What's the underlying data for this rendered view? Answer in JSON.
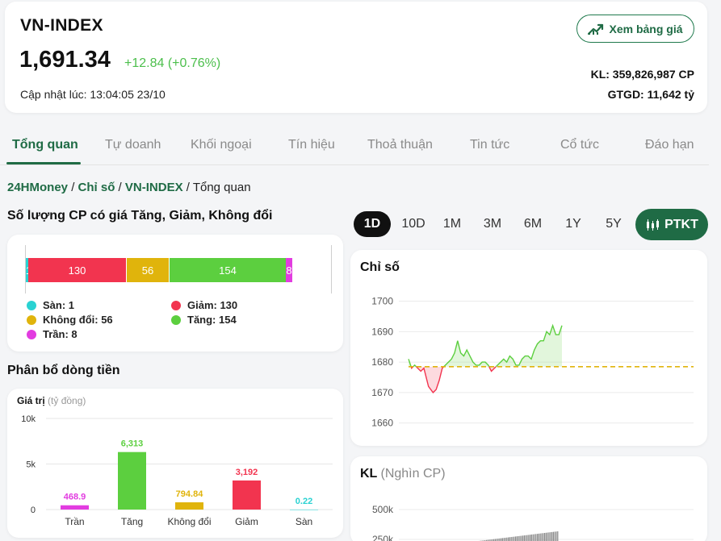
{
  "header": {
    "title": "VN-INDEX",
    "value": "1,691.34",
    "change": "+12.84 (+0.76%)",
    "update_time": "Cập nhật lúc: 13:04:05 23/10",
    "board_button": "Xem bảng giá",
    "volume": "KL: 359,826,987 CP",
    "value_traded": "GTGD: 11,642 tỷ"
  },
  "tabs": [
    "Tổng quan",
    "Tự doanh",
    "Khối ngoại",
    "Tín hiệu",
    "Thoả thuận",
    "Tin tức",
    "Cổ tức",
    "Đáo hạn"
  ],
  "breadcrumb": {
    "home": "24HMoney",
    "sep": " / ",
    "section": "Chỉ số",
    "index": "VN-INDEX",
    "current": "Tổng quan"
  },
  "breadth": {
    "title": "Số lượng CP có giá Tăng, Giảm, Không đổi",
    "bar_labels": {
      "san": "1",
      "giam": "130",
      "khong_doi": "56",
      "tang": "154",
      "tran": "8"
    },
    "legend": {
      "san": "Sàn: 1",
      "giam": "Giảm: 130",
      "khong_doi": "Không đổi: 56",
      "tang": "Tăng: 154",
      "tran": "Trần: 8"
    }
  },
  "flow": {
    "title": "Phân bổ dòng tiền",
    "axis_label": "Giá trị",
    "axis_unit": "(tỷ đồng)"
  },
  "range_buttons": [
    "1D",
    "10D",
    "1M",
    "3M",
    "6M",
    "1Y",
    "5Y"
  ],
  "ptkt_label": "PTKT",
  "index_chart": {
    "title": "Chỉ số"
  },
  "kl_chart": {
    "title": "KL",
    "unit": "(Nghìn CP)",
    "ticks": [
      "500k",
      "250k"
    ]
  },
  "colors": {
    "brand": "#1f6b45",
    "up": "#5ccf3f",
    "down": "#f2344f",
    "flat": "#e0b40c",
    "ceiling": "#e23ce0",
    "floor": "#2ad2d2"
  },
  "chart_data": [
    {
      "type": "bar",
      "stacked": true,
      "orientation": "horizontal",
      "categories": [
        "Sàn",
        "Giảm",
        "Không đổi",
        "Tăng",
        "Trần"
      ],
      "values": [
        1,
        130,
        56,
        154,
        8
      ],
      "colors": [
        "#2ad2d2",
        "#f2344f",
        "#e0b40c",
        "#5ccf3f",
        "#e23ce0"
      ]
    },
    {
      "type": "bar",
      "categories": [
        "Trần",
        "Tăng",
        "Không đổi",
        "Giảm",
        "Sàn"
      ],
      "values": [
        468.9,
        6313,
        794.84,
        3192,
        0.22
      ],
      "value_labels": [
        "468.9",
        "6,313",
        "794.84",
        "3,192",
        "0.22"
      ],
      "colors": [
        "#e23ce0",
        "#5ccf3f",
        "#e0b40c",
        "#f2344f",
        "#2ad2d2"
      ],
      "ylabel": "Giá trị (tỷ đồng)",
      "ylim": [
        0,
        10000
      ],
      "yticks": [
        0,
        5000,
        10000
      ],
      "ytick_labels": [
        "0",
        "5k",
        "10k"
      ]
    },
    {
      "type": "line",
      "title": "Chỉ số",
      "reference": 1678.5,
      "ylim": [
        1657,
        1702
      ],
      "yticks": [
        1660,
        1670,
        1680,
        1690,
        1700
      ],
      "x": [
        0,
        0.02,
        0.04,
        0.06,
        0.08,
        0.1,
        0.13,
        0.16,
        0.18,
        0.2,
        0.22,
        0.24,
        0.26,
        0.28,
        0.3,
        0.32,
        0.34,
        0.36,
        0.38,
        0.4,
        0.42,
        0.44,
        0.46,
        0.48,
        0.5,
        0.52,
        0.54,
        0.56,
        0.58,
        0.6,
        0.62,
        0.64,
        0.66,
        0.68,
        0.7,
        0.72,
        0.74,
        0.76,
        0.78,
        0.8,
        0.82,
        0.84,
        0.86,
        0.88,
        0.9,
        0.92,
        0.94,
        0.96,
        0.98,
        1.0
      ],
      "values": [
        1681,
        1678,
        1679,
        1678,
        1677,
        1678,
        1672,
        1670,
        1671,
        1674,
        1678,
        1679,
        1680,
        1681,
        1683,
        1687,
        1683,
        1682,
        1684,
        1682,
        1680,
        1679,
        1679,
        1680,
        1680,
        1679,
        1677,
        1678,
        1679,
        1680,
        1681,
        1680,
        1682,
        1681,
        1679,
        1679,
        1681,
        1682,
        1682,
        1681,
        1684,
        1686,
        1687,
        1687,
        1690,
        1689,
        1692,
        1689,
        1689,
        1692
      ]
    },
    {
      "type": "bar",
      "title": "KL",
      "ylabel": "(Nghìn CP)",
      "yticks": [
        250000,
        500000
      ],
      "ytick_labels": [
        "250k",
        "500k"
      ]
    }
  ]
}
